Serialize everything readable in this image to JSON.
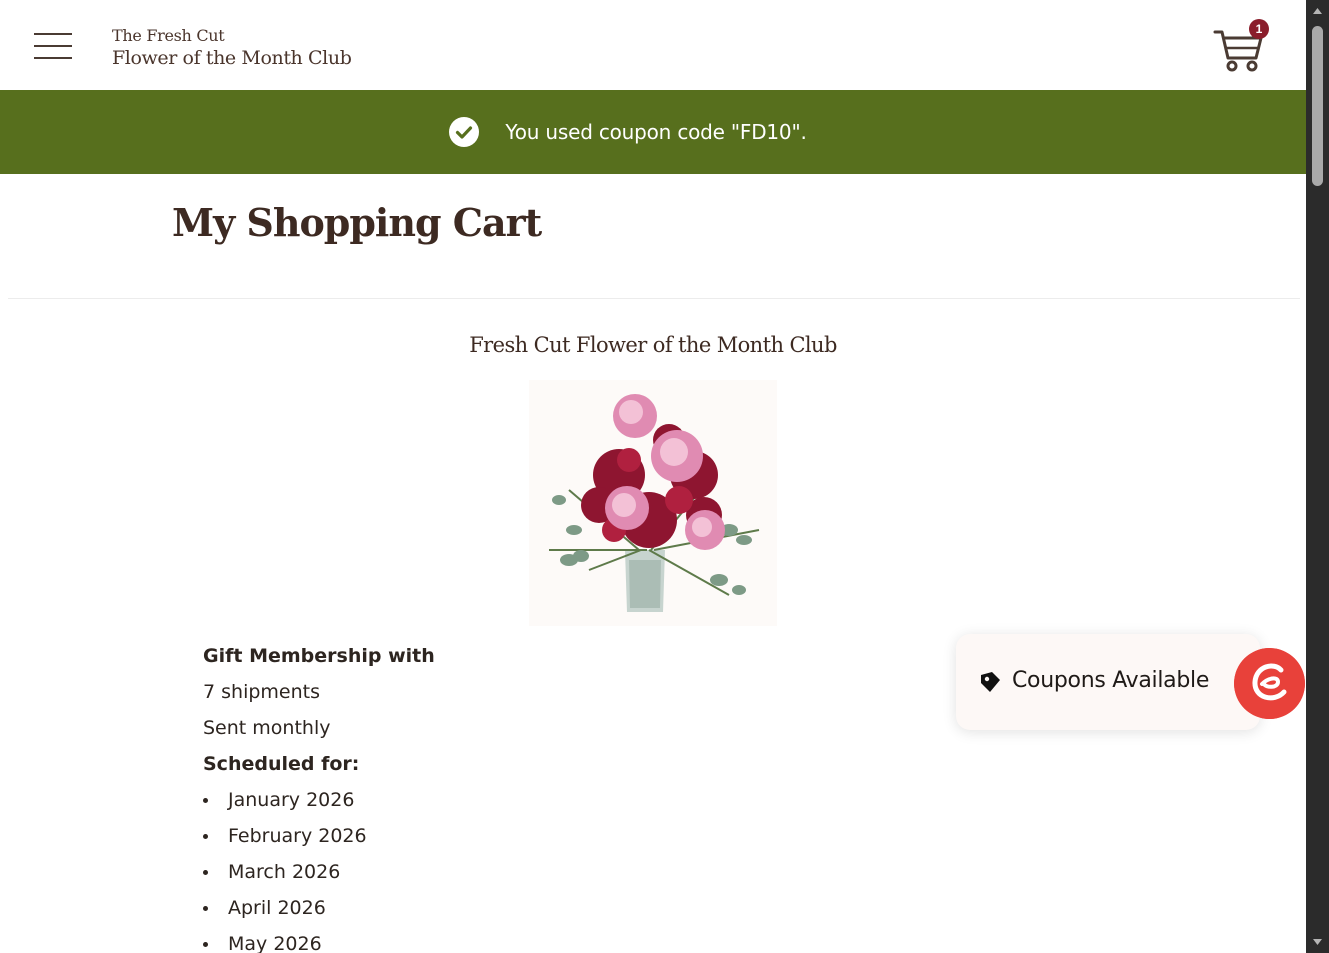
{
  "header": {
    "logo_line1": "The Fresh Cut",
    "logo_line2": "Flower of the Month Club",
    "cart_count": "1",
    "menu_icon": "hamburger-icon",
    "cart_icon": "shopping-cart-icon"
  },
  "banner": {
    "message": "You used coupon code \"FD10\".",
    "icon": "check-circle-icon",
    "color": "#576f1d"
  },
  "page": {
    "title": "My Shopping Cart"
  },
  "product": {
    "title": "Fresh Cut Flower of the Month Club",
    "image_alt": "flower-bouquet-image"
  },
  "details": {
    "membership": "Gift Membership with",
    "shipments": "7 shipments",
    "frequency": "Sent monthly",
    "scheduled_label": "Scheduled for:",
    "schedule": [
      "January 2026",
      "February 2026",
      "March 2026",
      "April 2026",
      "May 2026"
    ]
  },
  "coupons_widget": {
    "label": "Coupons Available",
    "icon": "tag-icon",
    "brand_color": "#e8413a"
  },
  "colors": {
    "accent": "#576f1d",
    "badge": "#8a1d2b",
    "text": "#3d2a22"
  }
}
